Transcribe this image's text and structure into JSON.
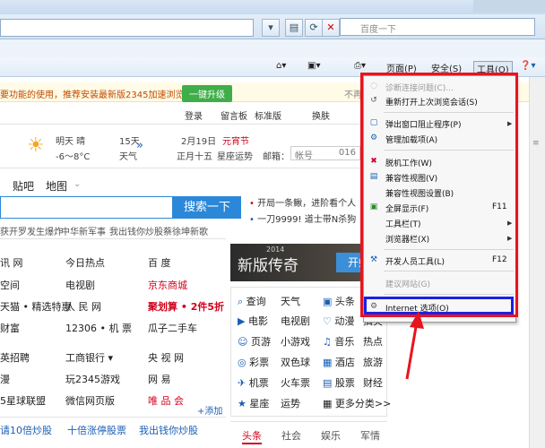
{
  "browser": {
    "search_placeholder": "百度一下",
    "command_bar": {
      "page": "页面(P)",
      "safety": "安全(S)",
      "tools": "工具(O)"
    }
  },
  "page": {
    "notice": {
      "text": "要功能的使用，推荐安装最新版2345加速浏览器：",
      "button": "一键升级",
      "right": "不再"
    },
    "toplinks": [
      "登录",
      "留言板",
      "标准版",
      "换肤"
    ],
    "weather": {
      "today": "明天 晴",
      "today_temp": "-6～8°C",
      "days": "15天",
      "days2": "天气",
      "date": "2月19日",
      "date2": "正月十五",
      "festival": "元宵节",
      "astro": "星座运势",
      "mail": "邮箱：",
      "account": "帐号",
      "code": "016"
    },
    "tabs": [
      "贴吧",
      "地图"
    ],
    "search_button": "搜索一下",
    "hot": [
      "开局一条鳅，进阶看个人",
      "一刀9999! 道士带N杀狗"
    ],
    "ticker": [
      "获开罗发生爆炸",
      "中华新军事",
      "我出钱你炒股",
      "蔡徐坤新歌"
    ],
    "grid": [
      [
        "讯 网",
        "今日热点",
        "百 度"
      ],
      [
        "空间",
        "电视剧",
        "京东商城"
      ],
      [
        "天猫 • 精选特惠",
        "人 民 网",
        "聚划算 • 2件5折"
      ],
      [
        "财富",
        "12306 • 机 票",
        "瓜子二手车"
      ],
      [
        "英招聘",
        "工商银行 ▾",
        "央 视 网"
      ],
      [
        "漫",
        "玩2345游戏",
        "网 易"
      ],
      [
        "5星球联盟",
        "微信网页版",
        "唯 品 会"
      ]
    ],
    "add_label": "+添加",
    "bottom_links": [
      "请10倍炒股",
      "十倍涨停股票",
      "我出钱你炒股"
    ],
    "banner": {
      "title": "新版传奇",
      "year": "2014",
      "action": "开始"
    },
    "services": [
      [
        "查询",
        "天气",
        "头条"
      ],
      [
        "电影",
        "电视剧",
        "动漫",
        "搞笑"
      ],
      [
        "页游",
        "小游戏",
        "音乐",
        "热点"
      ],
      [
        "彩票",
        "双色球",
        "酒店",
        "旅游"
      ],
      [
        "机票",
        "火车票",
        "股票",
        "财经"
      ],
      [
        "星座",
        "运势",
        "更多分类>>"
      ]
    ],
    "bottom_tabs": [
      "头条",
      "社会",
      "娱乐",
      "军情"
    ]
  },
  "menu": {
    "items": [
      {
        "label": "诊断连接问题(C)...",
        "disabled": true
      },
      {
        "label": "重新打开上次浏览会话(S)"
      },
      {
        "label": "弹出窗口阻止程序(P)",
        "submenu": true
      },
      {
        "label": "管理加载项(A)"
      },
      {
        "label": "脱机工作(W)"
      },
      {
        "label": "兼容性视图(V)"
      },
      {
        "label": "兼容性视图设置(B)"
      },
      {
        "label": "全屏显示(F)",
        "shortcut": "F11"
      },
      {
        "label": "工具栏(T)",
        "submenu": true
      },
      {
        "label": "浏览器栏(X)",
        "submenu": true
      },
      {
        "label": "开发人员工具(L)",
        "shortcut": "F12"
      },
      {
        "label": "建议网站(G)",
        "disabled": true
      },
      {
        "label": "Internet 选项(O)"
      }
    ]
  },
  "colors": {
    "highlight_red": "#e8141d",
    "highlight_blue": "#1a22e8",
    "search_button": "#2b88d8"
  }
}
